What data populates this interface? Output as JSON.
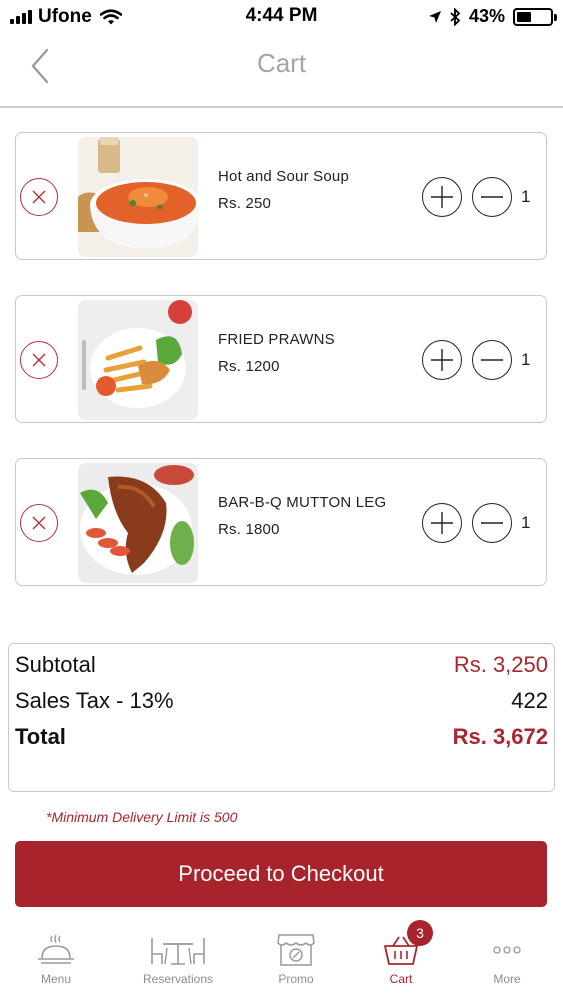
{
  "status_bar": {
    "carrier": "Ufone",
    "time": "4:44 PM",
    "battery": "43%",
    "battery_level": 0.43
  },
  "nav": {
    "title": "Cart",
    "back_icon": "chevron-left-icon"
  },
  "cart": {
    "items": [
      {
        "name": "Hot and Sour Soup",
        "price": "Rs. 250",
        "quantity": "1",
        "image": "soup-bowl"
      },
      {
        "name": "FRIED PRAWNS",
        "price": "Rs. 1200",
        "quantity": "1",
        "image": "fried-prawns-plate"
      },
      {
        "name": "BAR-B-Q MUTTON LEG",
        "price": "Rs. 1800",
        "quantity": "1",
        "image": "mutton-leg-platter"
      }
    ]
  },
  "summary": {
    "subtotal_label": "Subtotal",
    "subtotal_value": "Rs. 3,250",
    "tax_label": "Sales Tax - 13%",
    "tax_value": "422",
    "total_label": "Total",
    "total_value": "Rs. 3,672"
  },
  "min_delivery_note": "*Minimum Delivery Limit is 500",
  "checkout_label": "Proceed to Checkout",
  "tab_bar": {
    "tabs": [
      {
        "label": "Menu",
        "icon": "cloche-icon"
      },
      {
        "label": "Reservations",
        "icon": "dining-table-icon"
      },
      {
        "label": "Promo",
        "icon": "store-icon"
      },
      {
        "label": "Cart",
        "icon": "basket-icon"
      },
      {
        "label": "More",
        "icon": "more-dots-icon"
      }
    ],
    "active": "Cart",
    "cart_badge": "3"
  },
  "colors": {
    "accent": "#a9232c",
    "muted": "#a4a4a4"
  }
}
